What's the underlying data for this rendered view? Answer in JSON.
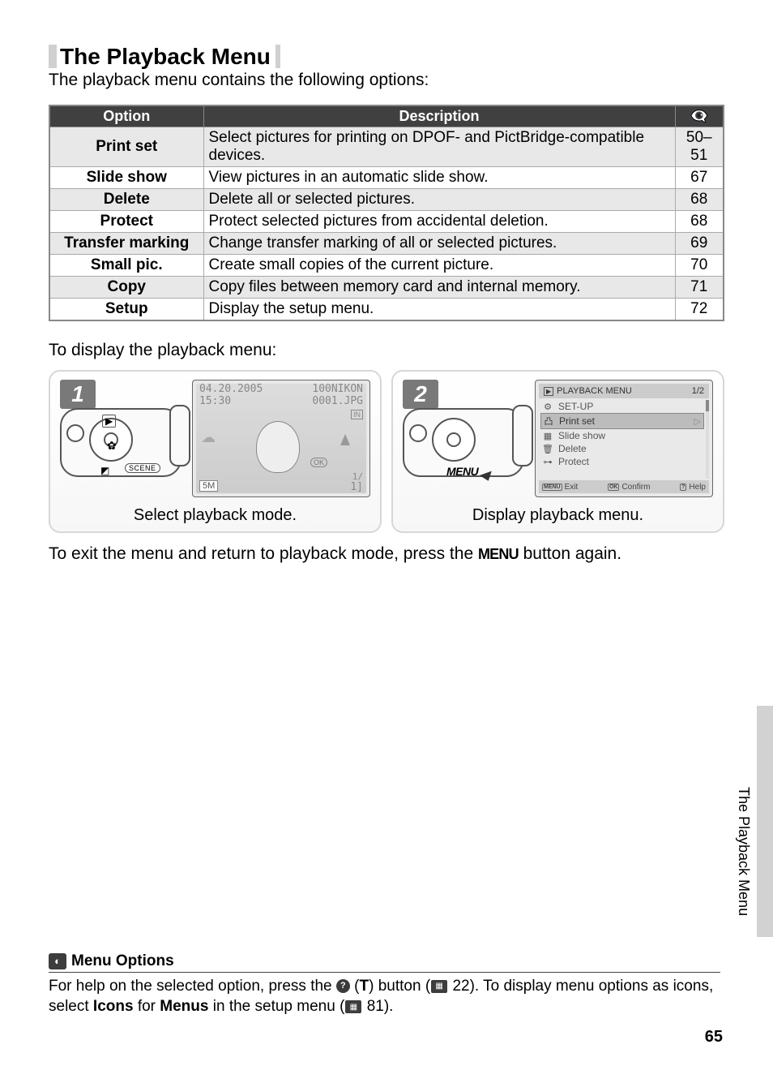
{
  "title": "The Playback Menu",
  "intro": "The playback menu contains the following options:",
  "tableHeaders": {
    "option": "Option",
    "description": "Description"
  },
  "rows": [
    {
      "opt": "Print set",
      "desc": "Select pictures for printing on DPOF- and PictBridge-compatible devices.",
      "pg": "50–51",
      "shade": true
    },
    {
      "opt": "Slide show",
      "desc": "View pictures in an automatic slide show.",
      "pg": "67",
      "shade": false
    },
    {
      "opt": "Delete",
      "desc": "Delete all or selected pictures.",
      "pg": "68",
      "shade": true
    },
    {
      "opt": "Protect",
      "desc": "Protect selected pictures from accidental deletion.",
      "pg": "68",
      "shade": false
    },
    {
      "opt": "Transfer marking",
      "desc": "Change transfer marking of all or selected pictures.",
      "pg": "69",
      "shade": true
    },
    {
      "opt": "Small pic.",
      "desc": "Create small copies of the current picture.",
      "pg": "70",
      "shade": false
    },
    {
      "opt": "Copy",
      "desc": "Copy files between memory card and internal memory.",
      "pg": "71",
      "shade": true
    },
    {
      "opt": "Setup",
      "desc": "Display the setup menu.",
      "pg": "72",
      "shade": false
    }
  ],
  "displayText": "To display the playback menu:",
  "step1": {
    "num": "1",
    "date": "04.20.2005",
    "time": "15:30",
    "folder": "100NIKON",
    "file": "0001.JPG",
    "in": "IN",
    "size": "5M",
    "counter_top": "1/",
    "counter_bot": "1]",
    "ok": "OK",
    "scene": "SCENE",
    "caption": "Select playback mode."
  },
  "step2": {
    "num": "2",
    "menuBtn": "MENU",
    "screenTitle": "PLAYBACK MENU",
    "screenPage": "1/2",
    "items": [
      {
        "icon": "⚙",
        "label": "SET-UP",
        "hl": false
      },
      {
        "icon": "凸",
        "label": "Print set",
        "hl": true
      },
      {
        "icon": "▦",
        "label": "Slide show",
        "hl": false
      },
      {
        "icon": "🗑",
        "label": "Delete",
        "hl": false
      },
      {
        "icon": "⊶",
        "label": "Protect",
        "hl": false
      }
    ],
    "footer": {
      "exitTag": "MENU",
      "exit": "Exit",
      "confirmTag": "OK",
      "confirm": "Confirm",
      "helpTag": "?",
      "help": "Help"
    },
    "caption": "Display playback menu."
  },
  "exitLine": {
    "pre": "To exit the menu and return to playback mode, press the ",
    "btn": "MENU",
    "post": " button again."
  },
  "sideLabel": "The Playback Menu",
  "note": {
    "title": "Menu Options",
    "line1a": "For help on the selected option, press the ",
    "t": "T",
    "line1b": ") button (",
    "ref1": "22",
    "line1c": ").  To display menu options as icons, select ",
    "icons": "Icons",
    "for": " for ",
    "menus": "Menus",
    "line2a": " in the setup menu (",
    "ref2": "81",
    "line2b": ")."
  },
  "pageNum": "65"
}
